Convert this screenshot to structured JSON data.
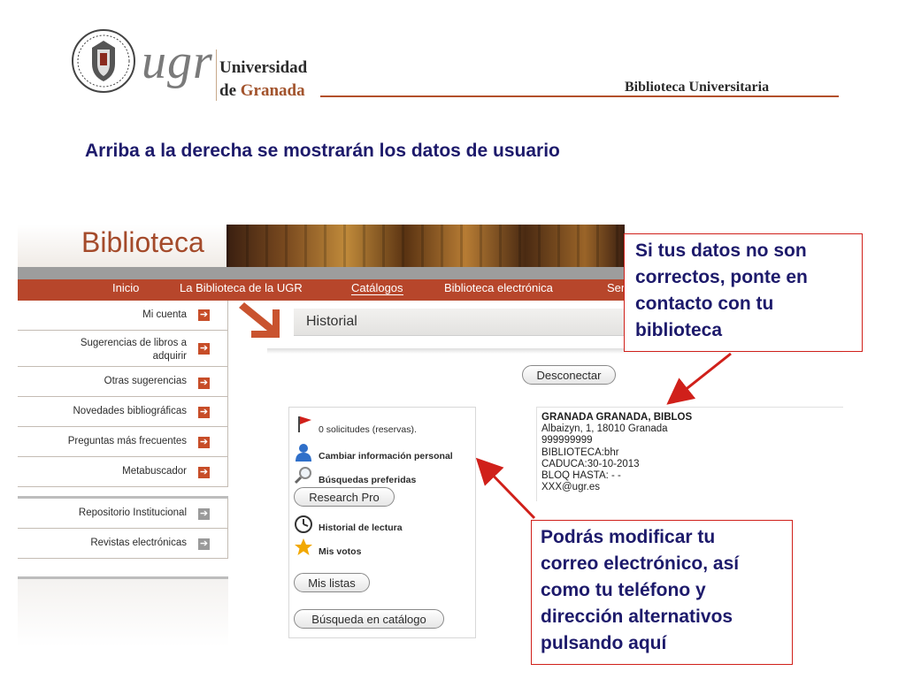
{
  "header": {
    "logo_text": "ugr",
    "university_line1": "Universidad",
    "university_line2_prefix": "de ",
    "university_line2_accent": "Granada",
    "library_title": "Biblioteca Universitaria"
  },
  "slide": {
    "heading": "Arriba a la derecha se mostrarán los datos de usuario"
  },
  "site": {
    "title": "Biblioteca",
    "nav": [
      "Inicio",
      "La Biblioteca de la UGR",
      "Catálogos",
      "Biblioteca electrónica",
      "Ser"
    ],
    "sidebar_main": [
      {
        "label": "Mi cuenta"
      },
      {
        "label": "Sugerencias de libros a adquirir"
      },
      {
        "label": "Otras sugerencias"
      },
      {
        "label": "Novedades bibliográficas"
      },
      {
        "label": "Preguntas más frecuentes"
      },
      {
        "label": "Metabuscador"
      }
    ],
    "sidebar_secondary": [
      {
        "label": "Repositorio Institucional"
      },
      {
        "label": "Revistas electrónicas"
      }
    ],
    "section_title": "Historial",
    "disconnect_button": "Desconectar",
    "menu": {
      "requests": "0 solicitudes (reservas).",
      "change_info": "Cambiar información personal",
      "saved_searches": "Búsquedas preferidas",
      "research_pro": "Research Pro",
      "reading_history": "Historial de lectura",
      "my_votes": "Mis votos",
      "my_lists": "Mis listas",
      "catalog_search": "Búsqueda en catálogo"
    },
    "user_data": [
      "GRANADA GRANADA, BIBLOS",
      "Albaizyn, 1, 18010 Granada",
      "999999999",
      "BIBLIOTECA:bhr",
      "CADUCA:30-10-2013",
      "BLOQ HASTA: - -",
      "XXX@ugr.es"
    ]
  },
  "callouts": {
    "top_right": [
      "Si tus datos no son",
      "correctos, ponte en",
      "contacto con tu",
      "biblioteca"
    ],
    "bottom": [
      "Podrás modificar tu",
      "correo electrónico, así",
      "como tu teléfono y",
      "dirección alternativos",
      "pulsando aquí"
    ]
  },
  "colors": {
    "brand_red": "#b7462b",
    "heading_blue": "#1d1a6b",
    "callout_border": "#d0201a"
  }
}
